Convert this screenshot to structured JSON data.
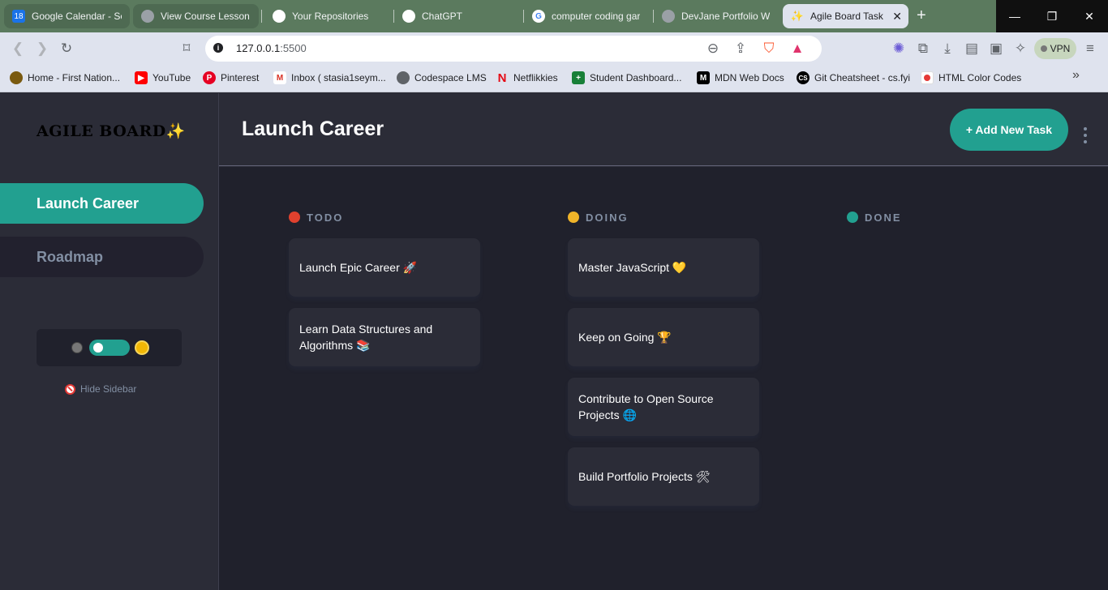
{
  "browser": {
    "tabs": [
      {
        "title": "Google Calendar - Se"
      },
      {
        "title": "View Course Lesson |"
      },
      {
        "title": "Your Repositories"
      },
      {
        "title": "ChatGPT"
      },
      {
        "title": "computer coding gar"
      },
      {
        "title": "DevJane Portfolio W"
      },
      {
        "title": "Agile Board Task"
      }
    ],
    "url_host": "127.0.0.1",
    "url_port": ":5500",
    "vpn_label": "VPN",
    "bookmarks": [
      {
        "label": "Home - First Nation..."
      },
      {
        "label": "YouTube"
      },
      {
        "label": "Pinterest"
      },
      {
        "label": "Inbox ( stasia1seym..."
      },
      {
        "label": "Codespace LMS"
      },
      {
        "label": "Netflikkies"
      },
      {
        "label": "Student Dashboard..."
      },
      {
        "label": "MDN Web Docs"
      },
      {
        "label": "Git Cheatsheet - cs.fyi"
      },
      {
        "label": "HTML Color Codes"
      }
    ]
  },
  "sidebar": {
    "logo": "AGILE BOARD",
    "logo_icon": "✨",
    "boards": [
      {
        "label": "Launch Career"
      },
      {
        "label": "Roadmap"
      }
    ],
    "hide_label": "Hide Sidebar"
  },
  "header": {
    "title": "Launch Career",
    "add_button": "+ Add New Task"
  },
  "columns": [
    {
      "name": "TODO",
      "color": "#e0412e",
      "tasks": [
        "Launch Epic Career 🚀",
        "Learn Data Structures and Algorithms 📚"
      ]
    },
    {
      "name": "DOING",
      "color": "#f0b429",
      "tasks": [
        "Master JavaScript 💛",
        "Keep on Going 🏆",
        "Contribute to Open Source Projects 🌐",
        "Build Portfolio Projects 🛠"
      ]
    },
    {
      "name": "DONE",
      "color": "#22a090",
      "tasks": []
    }
  ],
  "colors": {
    "accent": "#22a090",
    "sidebar_bg": "#2b2c37",
    "board_bg": "#20212c"
  }
}
